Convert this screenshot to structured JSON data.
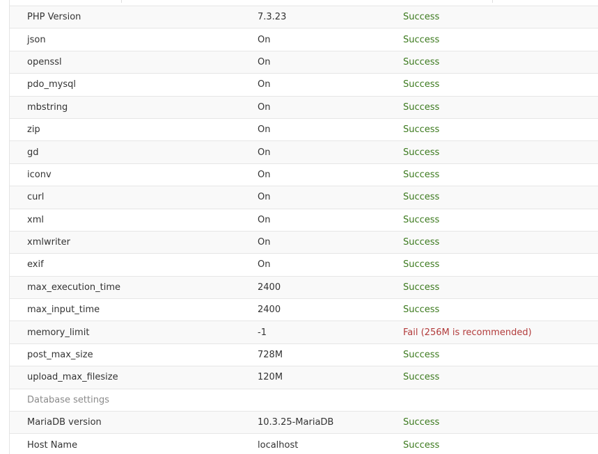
{
  "requirements": [
    {
      "name": "PHP Version",
      "value": "7.3.23",
      "status": "Success",
      "state": "success"
    },
    {
      "name": "json",
      "value": "On",
      "status": "Success",
      "state": "success"
    },
    {
      "name": "openssl",
      "value": "On",
      "status": "Success",
      "state": "success"
    },
    {
      "name": "pdo_mysql",
      "value": "On",
      "status": "Success",
      "state": "success"
    },
    {
      "name": "mbstring",
      "value": "On",
      "status": "Success",
      "state": "success"
    },
    {
      "name": "zip",
      "value": "On",
      "status": "Success",
      "state": "success"
    },
    {
      "name": "gd",
      "value": "On",
      "status": "Success",
      "state": "success"
    },
    {
      "name": "iconv",
      "value": "On",
      "status": "Success",
      "state": "success"
    },
    {
      "name": "curl",
      "value": "On",
      "status": "Success",
      "state": "success"
    },
    {
      "name": "xml",
      "value": "On",
      "status": "Success",
      "state": "success"
    },
    {
      "name": "xmlwriter",
      "value": "On",
      "status": "Success",
      "state": "success"
    },
    {
      "name": "exif",
      "value": "On",
      "status": "Success",
      "state": "success"
    },
    {
      "name": "max_execution_time",
      "value": "2400",
      "status": "Success",
      "state": "success"
    },
    {
      "name": "max_input_time",
      "value": "2400",
      "status": "Success",
      "state": "success"
    },
    {
      "name": "memory_limit",
      "value": "-1",
      "status": "Fail (256M is recommended)",
      "state": "fail"
    },
    {
      "name": "post_max_size",
      "value": "728M",
      "status": "Success",
      "state": "success"
    },
    {
      "name": "upload_max_filesize",
      "value": "120M",
      "status": "Success",
      "state": "success"
    }
  ],
  "database_section": {
    "heading": "Database settings",
    "rows": [
      {
        "name": "MariaDB version",
        "value": "10.3.25-MariaDB",
        "status": "Success",
        "state": "success"
      },
      {
        "name": "Host Name",
        "value": "localhost",
        "status": "Success",
        "state": "success"
      }
    ]
  },
  "colors": {
    "success": "#3c7a1e",
    "fail": "#b23b3b",
    "section_heading": "#8a8a8a",
    "row_stripe": "#f9f9f9",
    "border": "#e6e6e6"
  }
}
